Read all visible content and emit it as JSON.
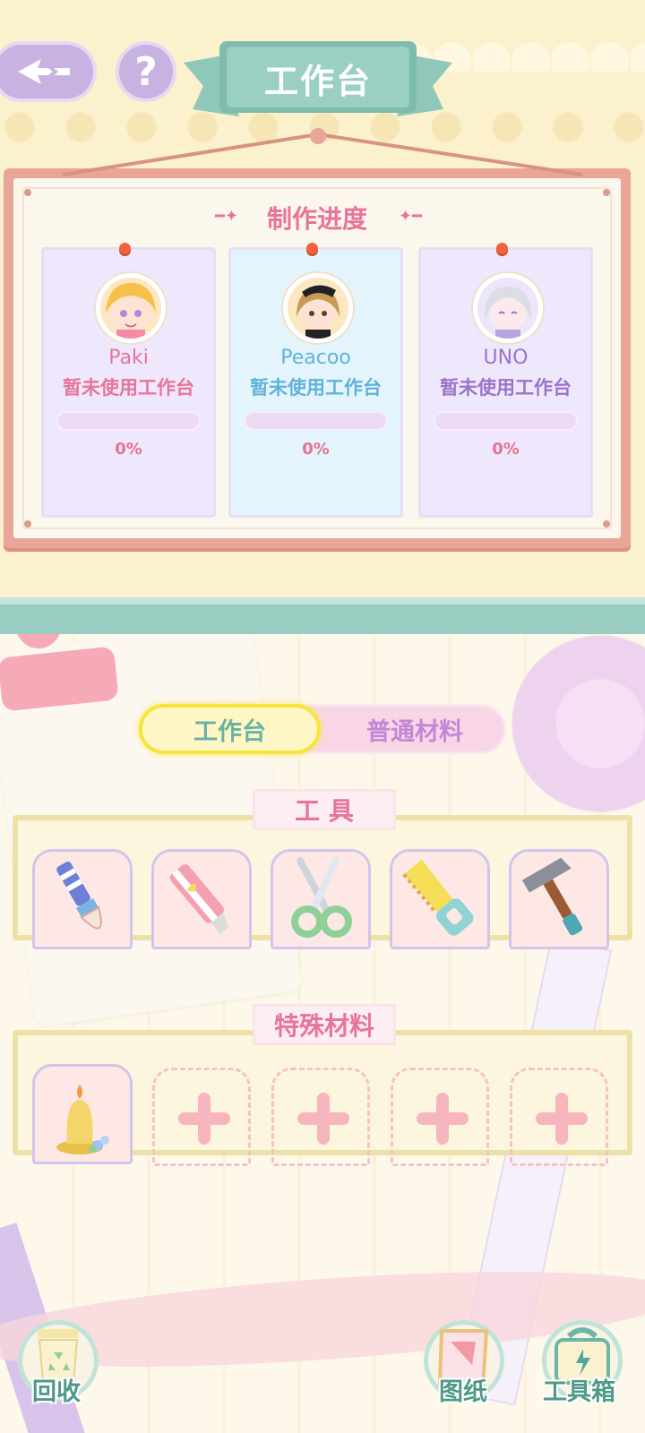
{
  "header": {
    "title": "工作台",
    "back_icon": "back-arrow-icon",
    "help_label": "?"
  },
  "progress_board": {
    "heading": "制作进度",
    "cards": [
      {
        "name": "Paki",
        "status": "暂未使用工作台",
        "progress": 0,
        "progress_label": "0%",
        "name_color": "#e8749a",
        "status_color": "#e8749a",
        "bg": "#efe7fb"
      },
      {
        "name": "Peacoo",
        "status": "暂未使用工作台",
        "progress": 0,
        "progress_label": "0%",
        "name_color": "#5fb3d8",
        "status_color": "#5fb3d8",
        "bg": "#e4f4fd"
      },
      {
        "name": "UNO",
        "status": "暂未使用工作台",
        "progress": 0,
        "progress_label": "0%",
        "name_color": "#9a74c8",
        "status_color": "#9a74c8",
        "bg": "#efe7fb"
      }
    ]
  },
  "tabs": {
    "active": "工作台",
    "inactive": "普通材料"
  },
  "tools_section": {
    "label": "工 具",
    "items": [
      "brush-icon",
      "box-cutter-icon",
      "scissors-icon",
      "saw-icon",
      "hammer-icon"
    ]
  },
  "special_section": {
    "label": "特殊材料",
    "items": [
      "candle-item-icon",
      "add-slot",
      "add-slot",
      "add-slot",
      "add-slot"
    ]
  },
  "bottom_nav": {
    "recycle": "回收",
    "blueprint": "图纸",
    "toolbox": "工具箱"
  }
}
